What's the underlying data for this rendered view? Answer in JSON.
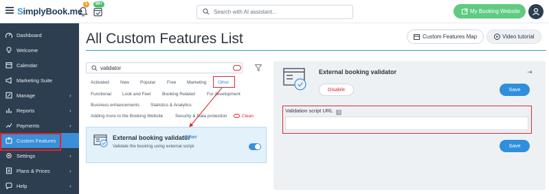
{
  "app": {
    "logo_prefix": "S",
    "logo_rest": "implyBook.me",
    "notification_count": "1",
    "calendar_badge": "99+"
  },
  "search": {
    "placeholder": "Search with AI assistant..."
  },
  "header": {
    "my_booking_label": "My Booking Website"
  },
  "sidebar": {
    "items": [
      {
        "label": "Dashboard",
        "icon": "dashboard-icon",
        "chevron": false
      },
      {
        "label": "Welcome",
        "icon": "bulb-icon",
        "chevron": false
      },
      {
        "label": "Calendar",
        "icon": "calendar-icon",
        "chevron": false
      },
      {
        "label": "Marketing Suite",
        "icon": "megaphone-icon",
        "chevron": false
      },
      {
        "label": "Manage",
        "icon": "edit-icon",
        "chevron": true
      },
      {
        "label": "Reports",
        "icon": "bar-chart-icon",
        "chevron": true
      },
      {
        "label": "Payments",
        "icon": "payment-icon",
        "chevron": true
      },
      {
        "label": "Custom Features",
        "icon": "puzzle-icon",
        "chevron": false,
        "active": true
      },
      {
        "label": "Settings",
        "icon": "gear-icon",
        "chevron": true
      },
      {
        "label": "Plans & Prices",
        "icon": "plans-icon",
        "chevron": true
      },
      {
        "label": "Help",
        "icon": "help-icon",
        "chevron": true
      }
    ]
  },
  "main": {
    "title": "All Custom Features List",
    "map_button": "Custom Features Map",
    "video_button": "Video tutorial"
  },
  "filter": {
    "search_value": "validator",
    "tags": [
      "Activated",
      "New",
      "Popular",
      "Free",
      "Marketing",
      "Other",
      "Functional",
      "Look and Feel",
      "Booking Related",
      "For development",
      "Business enhancements",
      "Statistics & Analytics",
      "Adding more to the Booking Website",
      "Security & Data protection"
    ],
    "selected_tag": "Other",
    "clean_label": "Clean"
  },
  "feature": {
    "title": "External booking validator",
    "tag": "Other",
    "description": "Validate the booking using external script.",
    "enabled": true
  },
  "detail": {
    "title": "External booking validator",
    "disable_label": "Disable",
    "save_label": "Save",
    "save_label_2": "Save",
    "url_label": "Validation script URL",
    "url_value": ""
  },
  "colors": {
    "sidebar_bg": "#2c3e50",
    "accent": "#3a8fd8",
    "highlight_red": "#e0242c",
    "green": "#5fcb80"
  }
}
